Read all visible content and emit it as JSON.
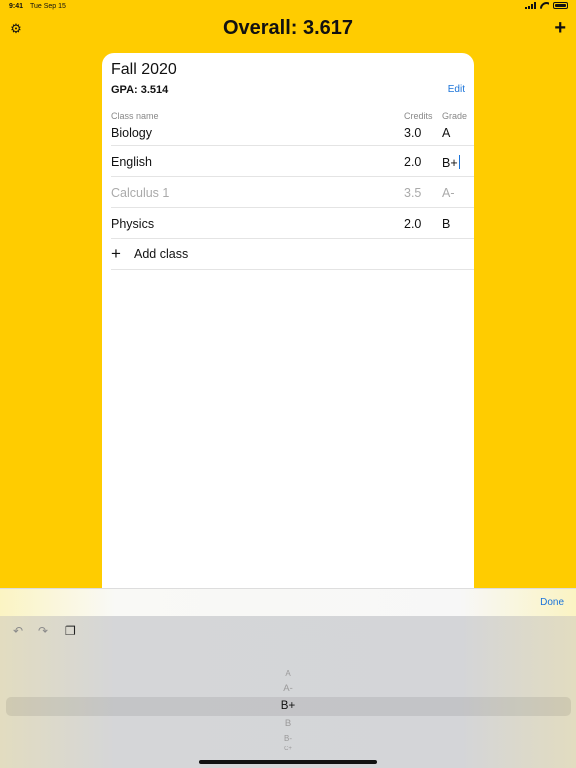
{
  "status_bar": {
    "time": "9:41",
    "date": "Tue Sep 15"
  },
  "header": {
    "title": "Overall: 3.617"
  },
  "term": {
    "name": "Fall 2020",
    "gpa": "GPA: 3.514",
    "edit_label": "Edit",
    "columns": {
      "class_name": "Class name",
      "credits": "Credits",
      "grade": "Grade"
    },
    "classes": [
      {
        "name": "Biology",
        "credits": "3.0",
        "grade": "A"
      },
      {
        "name": "English",
        "credits": "2.0",
        "grade": "B+"
      },
      {
        "name": "Calculus 1",
        "credits": "3.5",
        "grade": "A-"
      },
      {
        "name": "Physics",
        "credits": "2.0",
        "grade": "B"
      }
    ],
    "add_class_label": "Add class"
  },
  "accessory": {
    "done_label": "Done"
  },
  "picker": {
    "options": [
      "A",
      "A-",
      "B+",
      "B",
      "B-",
      "C+"
    ],
    "selected": "B+"
  },
  "icons": {
    "settings": "gear-icon",
    "add_term": "plus-icon",
    "add_class": "plus-icon",
    "undo": "undo-icon",
    "redo": "redo-icon",
    "paste": "paste-icon"
  },
  "colors": {
    "background": "#FFCC00",
    "accent": "#1A73D9",
    "card": "#FFFFFF",
    "dimmed_text": "#AAAAAA"
  }
}
